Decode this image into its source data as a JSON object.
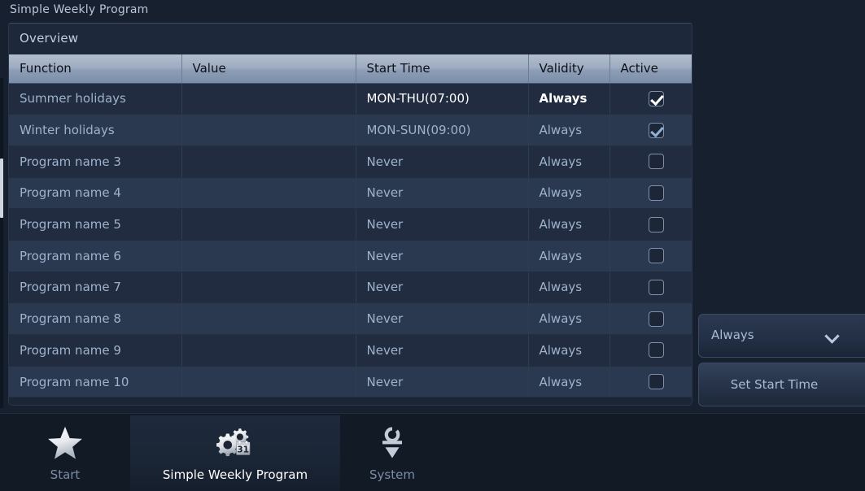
{
  "window": {
    "title": "Simple Weekly Program"
  },
  "overview": {
    "title": "Overview"
  },
  "table": {
    "columns": [
      "Function",
      "Value",
      "Start Time",
      "Validity",
      "Active"
    ],
    "rows": [
      {
        "function": "Summer holidays",
        "value": "",
        "start_time": "MON-THU(07:00)",
        "validity": "Always",
        "active": true
      },
      {
        "function": "Winter holidays",
        "value": "",
        "start_time": "MON-SUN(09:00)",
        "validity": "Always",
        "active": true
      },
      {
        "function": "Program name 3",
        "value": "",
        "start_time": "Never",
        "validity": "Always",
        "active": false
      },
      {
        "function": "Program name 4",
        "value": "",
        "start_time": "Never",
        "validity": "Always",
        "active": false
      },
      {
        "function": "Program name 5",
        "value": "",
        "start_time": "Never",
        "validity": "Always",
        "active": false
      },
      {
        "function": "Program name 6",
        "value": "",
        "start_time": "Never",
        "validity": "Always",
        "active": false
      },
      {
        "function": "Program name 7",
        "value": "",
        "start_time": "Never",
        "validity": "Always",
        "active": false
      },
      {
        "function": "Program name 8",
        "value": "",
        "start_time": "Never",
        "validity": "Always",
        "active": false
      },
      {
        "function": "Program name 9",
        "value": "",
        "start_time": "Never",
        "validity": "Always",
        "active": false
      },
      {
        "function": "Program name 10",
        "value": "",
        "start_time": "Never",
        "validity": "Always",
        "active": false
      }
    ]
  },
  "side_panel": {
    "validity_dropdown": {
      "selected": "Always",
      "chevron_icon": "chevron-down-icon"
    },
    "set_start_time_button": "Set Start Time"
  },
  "tabbar": {
    "tabs": [
      {
        "label": "Start",
        "icon": "star-icon",
        "active": false
      },
      {
        "label": "Simple Weekly Program",
        "icon": "gears-calendar-icon",
        "active": true
      },
      {
        "label": "System",
        "icon": "system-icon",
        "active": false
      }
    ]
  },
  "colors": {
    "background": "#16202e",
    "panel": "#1b2536",
    "row_odd": "#212c40",
    "row_even": "#2a3950",
    "header_top": "#b2bdce",
    "header_bottom": "#7b8da8",
    "text_muted": "#9fb2cc",
    "text_bright": "#ffffff",
    "accent_tab": "#1e2a3c"
  }
}
